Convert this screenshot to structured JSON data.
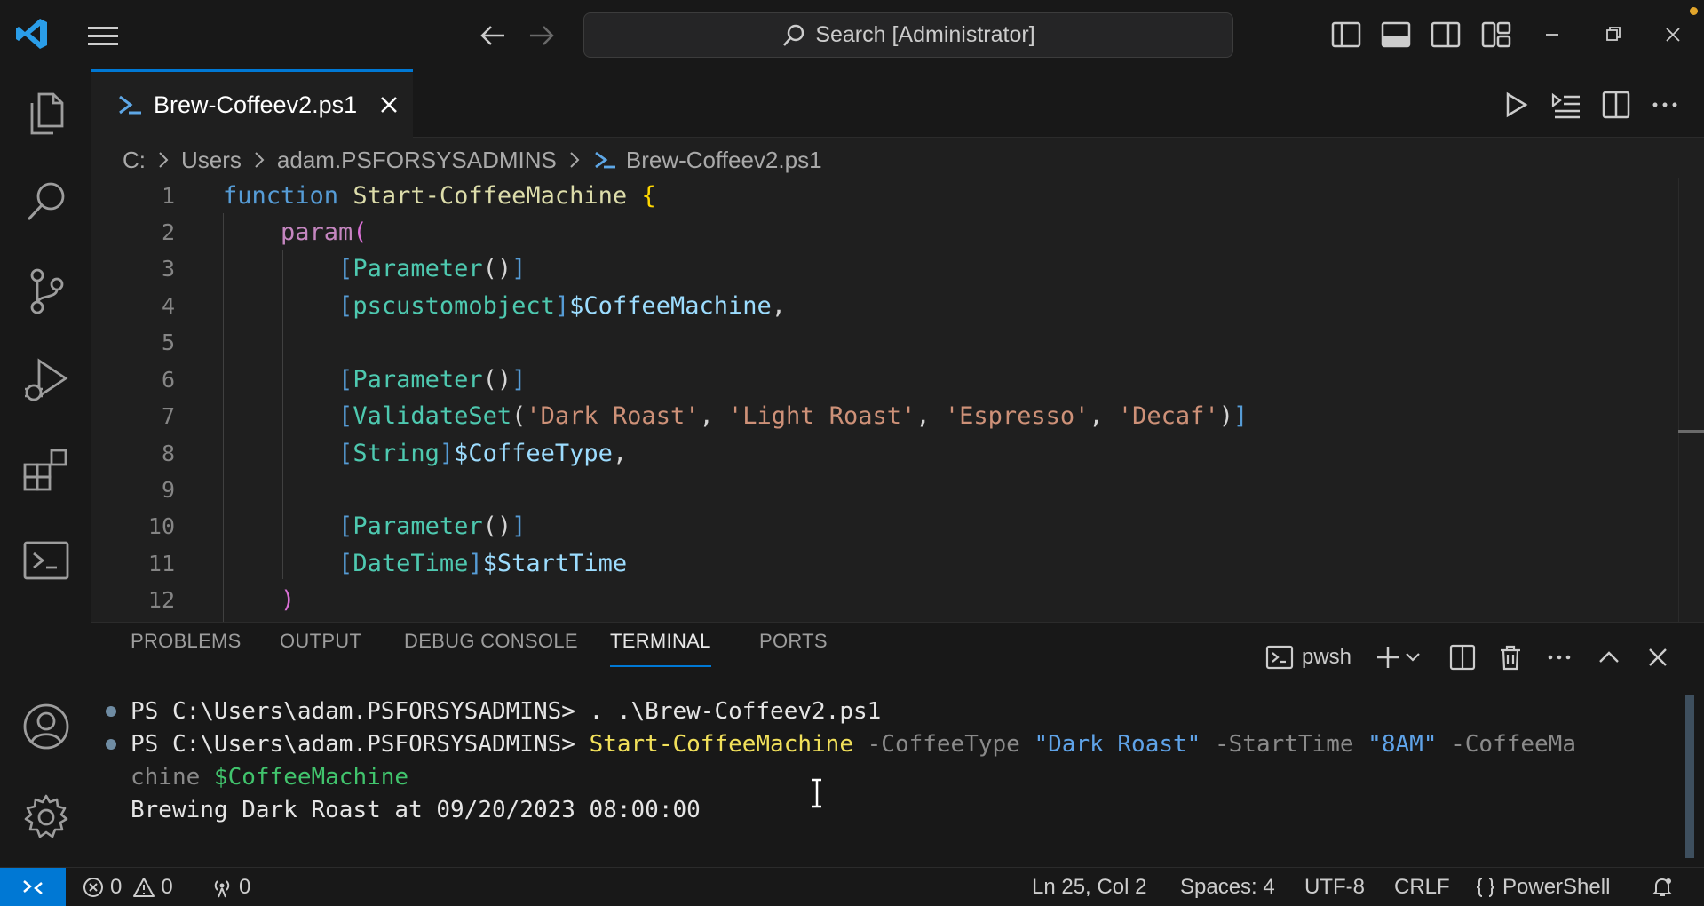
{
  "titlebar": {
    "search_placeholder": "Search [Administrator]"
  },
  "tab": {
    "label": "Brew-Coffeev2.ps1"
  },
  "breadcrumb": {
    "items": [
      "C:",
      "Users",
      "adam.PSFORSYSADMINS",
      "Brew-Coffeev2.ps1"
    ]
  },
  "editor": {
    "line_numbers": [
      "1",
      "2",
      "3",
      "4",
      "5",
      "6",
      "7",
      "8",
      "9",
      "10",
      "11",
      "12"
    ],
    "lines": [
      [
        {
          "t": "kw",
          "v": "function"
        },
        {
          "t": "plain",
          "v": " "
        },
        {
          "t": "fn",
          "v": "Start-CoffeeMachine"
        },
        {
          "t": "plain",
          "v": " "
        },
        {
          "t": "brace",
          "v": "{"
        }
      ],
      [
        {
          "t": "plain",
          "v": "    "
        },
        {
          "t": "ctrl",
          "v": "param"
        },
        {
          "t": "paren2",
          "v": "("
        }
      ],
      [
        {
          "t": "plain",
          "v": "        "
        },
        {
          "t": "bracket",
          "v": "["
        },
        {
          "t": "type",
          "v": "Parameter"
        },
        {
          "t": "plain",
          "v": "()"
        },
        {
          "t": "bracket",
          "v": "]"
        }
      ],
      [
        {
          "t": "plain",
          "v": "        "
        },
        {
          "t": "bracket",
          "v": "["
        },
        {
          "t": "type",
          "v": "pscustomobject"
        },
        {
          "t": "bracket",
          "v": "]"
        },
        {
          "t": "var",
          "v": "$CoffeeMachine"
        },
        {
          "t": "plain",
          "v": ","
        }
      ],
      [],
      [
        {
          "t": "plain",
          "v": "        "
        },
        {
          "t": "bracket",
          "v": "["
        },
        {
          "t": "type",
          "v": "Parameter"
        },
        {
          "t": "plain",
          "v": "()"
        },
        {
          "t": "bracket",
          "v": "]"
        }
      ],
      [
        {
          "t": "plain",
          "v": "        "
        },
        {
          "t": "bracket",
          "v": "["
        },
        {
          "t": "type",
          "v": "ValidateSet"
        },
        {
          "t": "plain",
          "v": "("
        },
        {
          "t": "str",
          "v": "'Dark Roast'"
        },
        {
          "t": "plain",
          "v": ", "
        },
        {
          "t": "str",
          "v": "'Light Roast'"
        },
        {
          "t": "plain",
          "v": ", "
        },
        {
          "t": "str",
          "v": "'Espresso'"
        },
        {
          "t": "plain",
          "v": ", "
        },
        {
          "t": "str",
          "v": "'Decaf'"
        },
        {
          "t": "plain",
          "v": ")"
        },
        {
          "t": "bracket",
          "v": "]"
        }
      ],
      [
        {
          "t": "plain",
          "v": "        "
        },
        {
          "t": "bracket",
          "v": "["
        },
        {
          "t": "type",
          "v": "String"
        },
        {
          "t": "bracket",
          "v": "]"
        },
        {
          "t": "var",
          "v": "$CoffeeType"
        },
        {
          "t": "plain",
          "v": ","
        }
      ],
      [],
      [
        {
          "t": "plain",
          "v": "        "
        },
        {
          "t": "bracket",
          "v": "["
        },
        {
          "t": "type",
          "v": "Parameter"
        },
        {
          "t": "plain",
          "v": "()"
        },
        {
          "t": "bracket",
          "v": "]"
        }
      ],
      [
        {
          "t": "plain",
          "v": "        "
        },
        {
          "t": "bracket",
          "v": "["
        },
        {
          "t": "type",
          "v": "DateTime"
        },
        {
          "t": "bracket",
          "v": "]"
        },
        {
          "t": "var",
          "v": "$StartTime"
        }
      ],
      [
        {
          "t": "plain",
          "v": "    "
        },
        {
          "t": "paren2",
          "v": ")"
        }
      ]
    ]
  },
  "panel": {
    "tabs": [
      "PROBLEMS",
      "OUTPUT",
      "DEBUG CONSOLE",
      "TERMINAL",
      "PORTS"
    ],
    "active_tab": "TERMINAL",
    "shell_label": "pwsh"
  },
  "terminal": {
    "line1_prompt": "PS C:\\Users\\adam.PSFORSYSADMINS> ",
    "line1_cmd": ". .\\Brew-Coffeev2.ps1",
    "line2_prompt": "PS C:\\Users\\adam.PSFORSYSADMINS> ",
    "line2_cmd": "Start-CoffeeMachine",
    "line2_param1": " -CoffeeType ",
    "line2_val1": "\"Dark Roast\"",
    "line2_param2": " -StartTime ",
    "line2_val2": "\"8AM\"",
    "line2_param3": " -CoffeeMa",
    "line3_param_cont": "chine ",
    "line3_var": "$CoffeeMachine",
    "output": "Brewing Dark Roast at 09/20/2023 08:00:00"
  },
  "statusbar": {
    "errors": "0",
    "warnings": "0",
    "ports": "0",
    "position": "Ln 25, Col 2",
    "spaces": "Spaces: 4",
    "encoding": "UTF-8",
    "eol": "CRLF",
    "language": "PowerShell"
  },
  "colors": {
    "accent": "#0078d4",
    "background": "#1f1f1f",
    "chrome": "#181818"
  }
}
